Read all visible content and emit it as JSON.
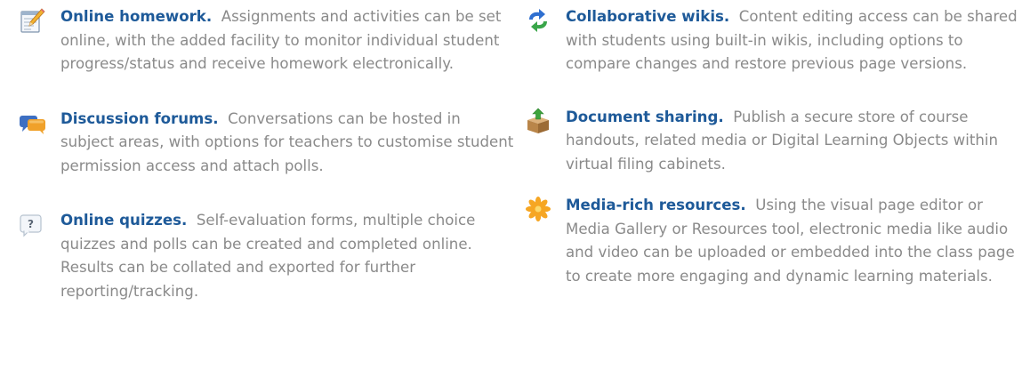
{
  "left_column": {
    "items": [
      {
        "icon": "homework-notepad-icon",
        "title": "Online homework.",
        "text": "Assignments and activities can be set online, with the added facility to monitor individual student progress/status and receive homework electronically."
      },
      {
        "icon": "discussion-bubbles-icon",
        "title": "Discussion forums.",
        "text": "Conversations can be hosted in subject areas, with options for teachers to customise student permission access and attach polls."
      },
      {
        "icon": "question-bubble-icon",
        "title": "Online quizzes.",
        "text": "Self-evaluation forms, multiple choice quizzes and polls can be created and completed online. Results can be collated and exported for further reporting/tracking."
      }
    ]
  },
  "right_column": {
    "items": [
      {
        "icon": "sync-arrows-icon",
        "title": "Collaborative wikis.",
        "text": "Content editing access can be shared with students using built-in wikis, including options to compare changes and restore previous page versions."
      },
      {
        "icon": "upload-box-icon",
        "title": "Document sharing.",
        "text": "Publish a secure store of course handouts, related media or Digital Learning Objects within virtual filing cabinets."
      },
      {
        "icon": "media-starburst-icon",
        "title": "Media-rich resources.",
        "text": "Using the visual page editor or Media Gallery or Resources tool, electronic media like audio and video can be uploaded or embedded into the class page to create more engaging and dynamic learning materials."
      }
    ]
  },
  "colors": {
    "title": "#1e5a99",
    "body_text": "#8a8a8a"
  }
}
